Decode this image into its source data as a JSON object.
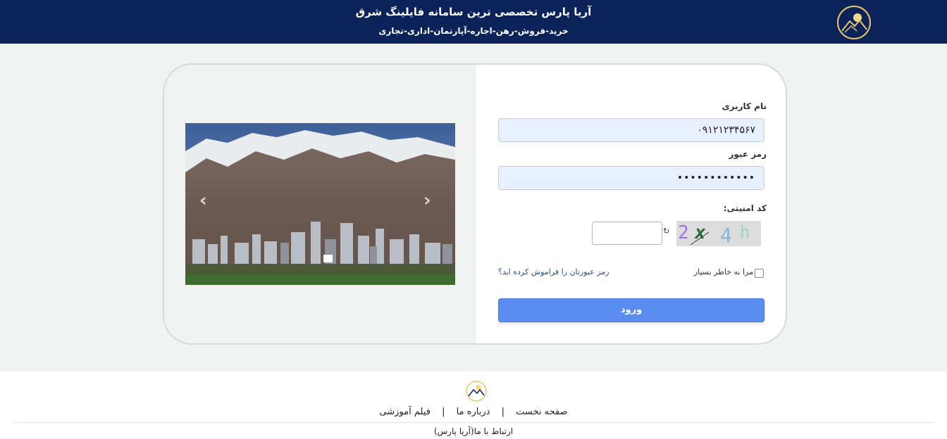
{
  "header": {
    "title": "آریا پارس تخصصی ترین سامانه فایلینگ شرق",
    "subtitle": "خرید-فروش-رهن-اجاره-آپارتمان-اداری-تجاری"
  },
  "login": {
    "username_label": "نام کاربری",
    "username_value": "۰۹۱۲۱۲۳۴۵۶۷",
    "password_label": "رمز عبور",
    "password_value": "••••••••••••",
    "captcha_label": "کد امنیتی:",
    "captcha_text": "2x4h",
    "refresh_icon": "refresh-icon",
    "remember_label": "مرا به خاطر بسپار",
    "forgot_link": "رمز عبورتان را فراموش کرده اید؟",
    "submit_label": "ورود"
  },
  "carousel": {
    "prev_glyph": "‹",
    "next_glyph": "›"
  },
  "footer": {
    "links": [
      "صفحه نخست",
      "درباره ما",
      "فیلم آموزشی"
    ],
    "separator": "|",
    "contact": "ارتباط با ما(آریا پارس)"
  },
  "colors": {
    "header_bg": "#0b2358",
    "primary_button": "#5a8def",
    "logo_gold": "#e8c46a"
  }
}
